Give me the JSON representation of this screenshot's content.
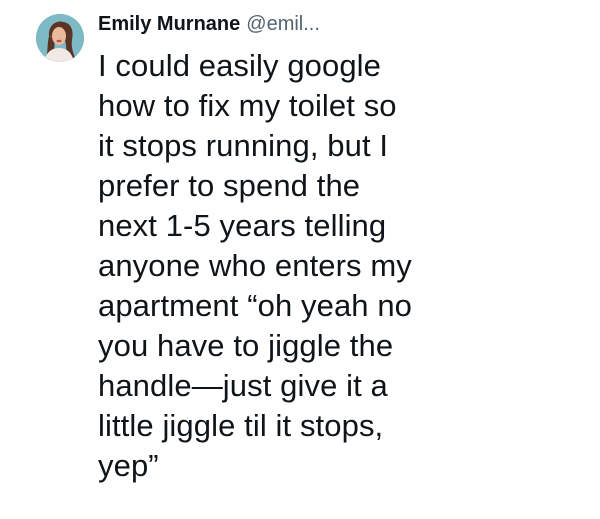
{
  "author": {
    "display_name": "Emily Murnane",
    "handle": "@emil..."
  },
  "tweet": {
    "lines": [
      "I could easily google",
      "how to fix my toilet so",
      "it stops running, but I",
      "prefer to spend the",
      "next 1-5 years telling",
      "anyone who enters my",
      "apartment “oh yeah no",
      "you have to jiggle the",
      "handle—just give it a",
      "little jiggle til it stops,",
      "yep”"
    ]
  },
  "colors": {
    "text": "#0f1419",
    "handle": "#536471",
    "background": "#ffffff"
  },
  "icons": {
    "avatar": "profile-photo"
  }
}
